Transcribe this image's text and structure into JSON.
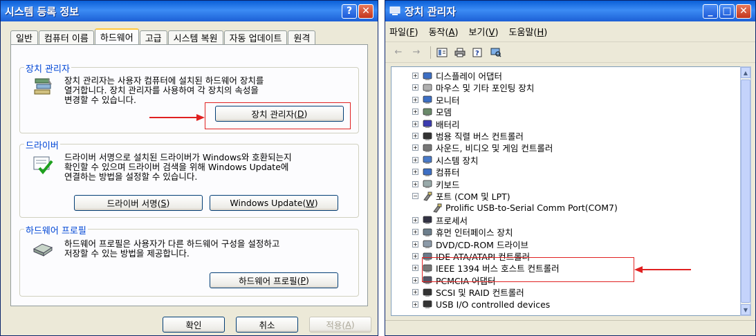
{
  "sysprops": {
    "title": "시스템 등록 정보",
    "help_label": "?",
    "close_label": "✕",
    "tabs": [
      "일반",
      "컴퓨터 이름",
      "하드웨어",
      "고급",
      "시스템 복원",
      "자동 업데이트",
      "원격"
    ],
    "device_manager": {
      "heading": "장치 관리자",
      "description": [
        "장치 관리자는 사용자 컴퓨터에 설치된 하드웨어 장치를",
        "열거합니다. 장치 관리자를 사용하여 각 장치의 속성을",
        "변경할 수 있습니다."
      ],
      "button_text": "장치 관리자(",
      "button_key": "D",
      "button_close": ")"
    },
    "drivers": {
      "heading": "드라이버",
      "description": [
        "드라이버 서명으로 설치된 드라이버가 Windows와 호환되는지",
        "확인할 수 있으며 드라이버 검색을 위해 Windows Update에",
        "연결하는 방법을 설정할 수 있습니다."
      ],
      "signing_text": "드라이버 서명(",
      "signing_key": "S",
      "signing_close": ")",
      "update_text": "Windows Update(",
      "update_key": "W",
      "update_close": ")"
    },
    "profiles": {
      "heading": "하드웨어 프로필",
      "description": [
        "하드웨어 프로필은 사용자가 다른 하드웨어 구성을 설정하고",
        "저장할 수 있는 방법을 제공합니다."
      ],
      "button_text": "하드웨어 프로필(",
      "button_key": "P",
      "button_close": ")"
    },
    "footer": {
      "ok": "확인",
      "cancel": "취소",
      "apply_text": "적용(",
      "apply_key": "A",
      "apply_close": ")"
    }
  },
  "devmgr": {
    "title": "장치 관리자",
    "minimize_label": "_",
    "maximize_label": "□",
    "close_label": "✕",
    "menus": [
      {
        "text": "파일(",
        "key": "F",
        "close": ")"
      },
      {
        "text": "동작(",
        "key": "A",
        "close": ")"
      },
      {
        "text": "보기(",
        "key": "V",
        "close": ")"
      },
      {
        "text": "도움말(",
        "key": "H",
        "close": ")"
      }
    ],
    "toolbar_icons": [
      "back-arrow-icon",
      "forward-arrow-icon",
      "properties-icon",
      "print-icon",
      "help-icon",
      "scan-hardware-icon"
    ],
    "tree": [
      {
        "label": "디스플레이 어댑터",
        "icon": "display-adapter-icon",
        "expander": "+"
      },
      {
        "label": "마우스 및 기타 포인팅 장치",
        "icon": "mouse-icon",
        "expander": "+"
      },
      {
        "label": "모니터",
        "icon": "monitor-icon",
        "expander": "+"
      },
      {
        "label": "모뎀",
        "icon": "modem-icon",
        "expander": "+"
      },
      {
        "label": "배터리",
        "icon": "battery-icon",
        "expander": "+"
      },
      {
        "label": "범용 직렬 버스 컨트롤러",
        "icon": "usb-icon",
        "expander": "+"
      },
      {
        "label": "사운드, 비디오 및 게임 컨트롤러",
        "icon": "sound-icon",
        "expander": "+"
      },
      {
        "label": "시스템 장치",
        "icon": "system-device-icon",
        "expander": "+"
      },
      {
        "label": "컴퓨터",
        "icon": "computer-icon",
        "expander": "+"
      },
      {
        "label": "키보드",
        "icon": "keyboard-icon",
        "expander": "+"
      },
      {
        "label": "포트 (COM 및 LPT)",
        "icon": "port-icon",
        "expander": "−"
      },
      {
        "label": "Prolific USB-to-Serial Comm Port(COM7)",
        "icon": "port-icon",
        "child": true
      },
      {
        "label": "프로세서",
        "icon": "processor-icon",
        "expander": "+"
      },
      {
        "label": "휴먼 인터페이스 장치",
        "icon": "hid-icon",
        "expander": "+"
      },
      {
        "label": "DVD/CD-ROM 드라이브",
        "icon": "cdrom-icon",
        "expander": "+"
      },
      {
        "label": "IDE ATA/ATAPI 컨트롤러",
        "icon": "ide-controller-icon",
        "expander": "+"
      },
      {
        "label": "IEEE 1394 버스 호스트 컨트롤러",
        "icon": "ieee1394-icon",
        "expander": "+"
      },
      {
        "label": "PCMCIA 어댑터",
        "icon": "pcmcia-icon",
        "expander": "+"
      },
      {
        "label": "SCSI 및 RAID 컨트롤러",
        "icon": "scsi-icon",
        "expander": "+"
      },
      {
        "label": "USB I/O controlled devices",
        "icon": "usb-icon",
        "expander": "+"
      }
    ]
  },
  "colors": {
    "title_blue": "#0a5fd8",
    "annotation_red": "#e02020",
    "group_title": "#0046d5"
  }
}
